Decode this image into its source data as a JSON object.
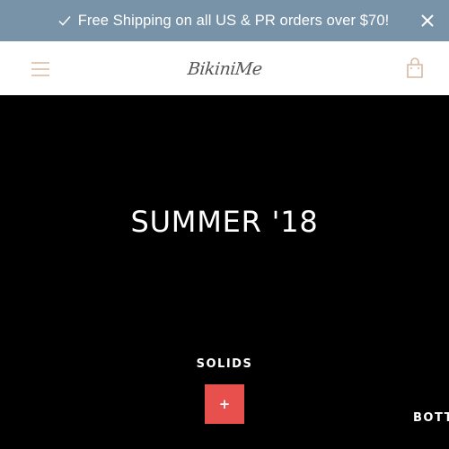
{
  "announcement": {
    "text": "Free Shipping on all US & PR orders over $70!",
    "bg_color": "#7893a8",
    "check_icon": "check-icon",
    "close_icon": "close-icon"
  },
  "header": {
    "logo_text": "BikiniMe",
    "menu_icon": "hamburger-menu-icon",
    "cart_icon": "shopping-bag-icon",
    "icon_color": "#d9b9a0"
  },
  "hero": {
    "title": "SUMMER '18",
    "collection_label": "SOLIDS",
    "plus_label": "+",
    "plus_color": "#e8504d",
    "side_label": "BOTT"
  }
}
